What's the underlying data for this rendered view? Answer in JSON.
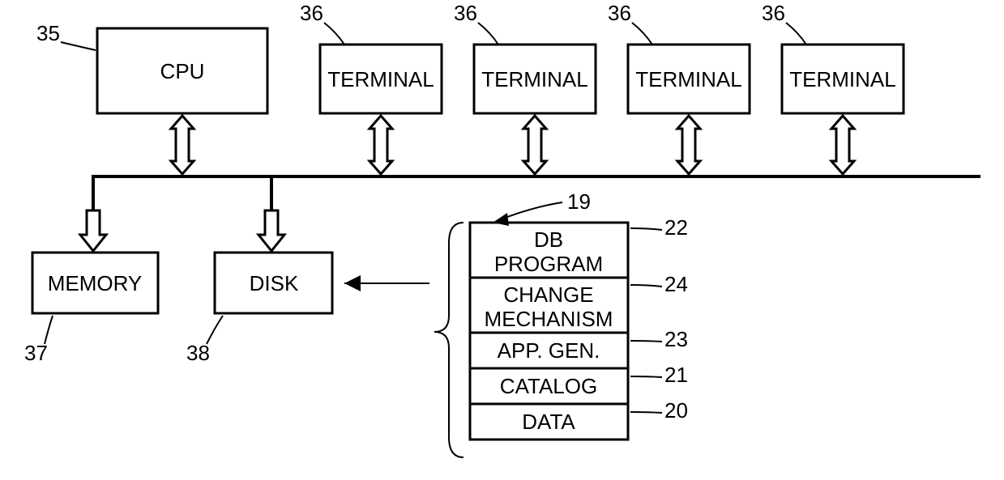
{
  "labels": {
    "cpu": "CPU",
    "terminal": "TERMINAL",
    "memory": "MEMORY",
    "disk": "DISK",
    "db_program_l1": "DB",
    "db_program_l2": "PROGRAM",
    "change_l1": "CHANGE",
    "change_l2": "MECHANISM",
    "appgen": "APP. GEN.",
    "catalog": "CATALOG",
    "data": "DATA"
  },
  "ref": {
    "r35": "35",
    "r36": "36",
    "r37": "37",
    "r38": "38",
    "r19": "19",
    "r22": "22",
    "r24": "24",
    "r23": "23",
    "r21": "21",
    "r20": "20"
  }
}
